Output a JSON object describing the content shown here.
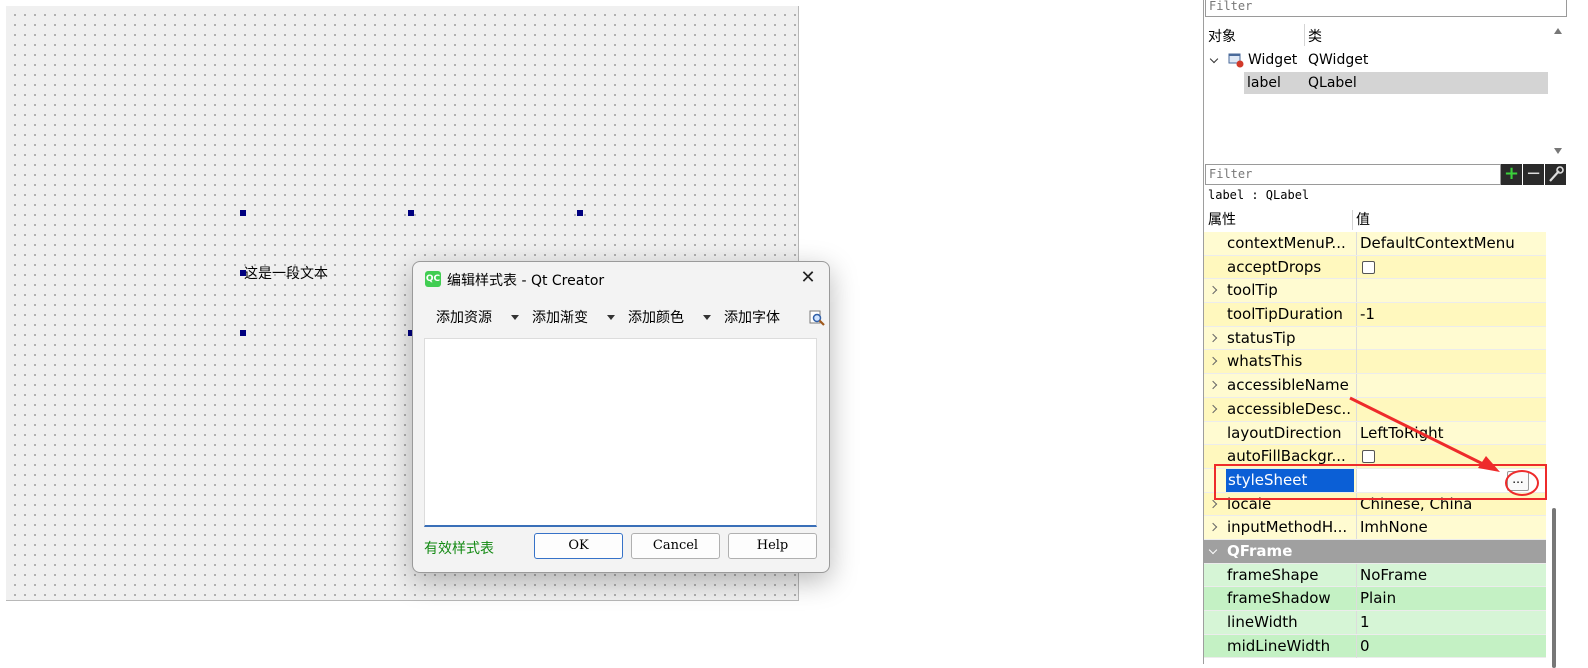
{
  "canvas": {
    "label_text": "这是一段文本"
  },
  "dialog": {
    "app_icon": "QC",
    "title": "编辑样式表 - Qt Creator",
    "close_glyph": "✕",
    "toolbar": {
      "add_resource": "添加资源",
      "add_gradient": "添加渐变",
      "add_color": "添加颜色",
      "add_font": "添加字体"
    },
    "status": "有效样式表",
    "ok": "OK",
    "cancel": "Cancel",
    "help": "Help"
  },
  "object_inspector": {
    "filter_placeholder": "Filter",
    "col_object": "对象",
    "col_class": "类",
    "rows": [
      {
        "name": "Widget",
        "class": "QWidget"
      },
      {
        "name": "label",
        "class": "QLabel"
      }
    ]
  },
  "property_editor": {
    "filter_placeholder": "Filter",
    "add_glyph": "+",
    "remove_glyph": "−",
    "object_class": "label : QLabel",
    "col_property": "属性",
    "col_value": "值",
    "rows": [
      {
        "name": "contextMenuP...",
        "value": "DefaultContextMenu"
      },
      {
        "name": "acceptDrops",
        "value": ""
      },
      {
        "name": "toolTip",
        "value": ""
      },
      {
        "name": "toolTipDuration",
        "value": "-1"
      },
      {
        "name": "statusTip",
        "value": ""
      },
      {
        "name": "whatsThis",
        "value": ""
      },
      {
        "name": "accessibleName",
        "value": ""
      },
      {
        "name": "accessibleDesc...",
        "value": ""
      },
      {
        "name": "layoutDirection",
        "value": "LeftToRight"
      },
      {
        "name": "autoFillBackgr...",
        "value": ""
      },
      {
        "name": "styleSheet",
        "value": ""
      },
      {
        "name": "locale",
        "value": "Chinese, China"
      },
      {
        "name": "inputMethodH...",
        "value": "ImhNone"
      },
      {
        "name": "QFrame",
        "value": ""
      },
      {
        "name": "frameShape",
        "value": "NoFrame"
      },
      {
        "name": "frameShadow",
        "value": "Plain"
      },
      {
        "name": "lineWidth",
        "value": "1"
      },
      {
        "name": "midLineWidth",
        "value": "0"
      }
    ],
    "ellipsis_label": "..."
  },
  "colors": {
    "selection": "#0b5fd6",
    "annotation_red": "#ee2b2b",
    "row_yellow": "#fffbd1",
    "row_green": "#d6f5d6",
    "status_green": "#138a13"
  }
}
